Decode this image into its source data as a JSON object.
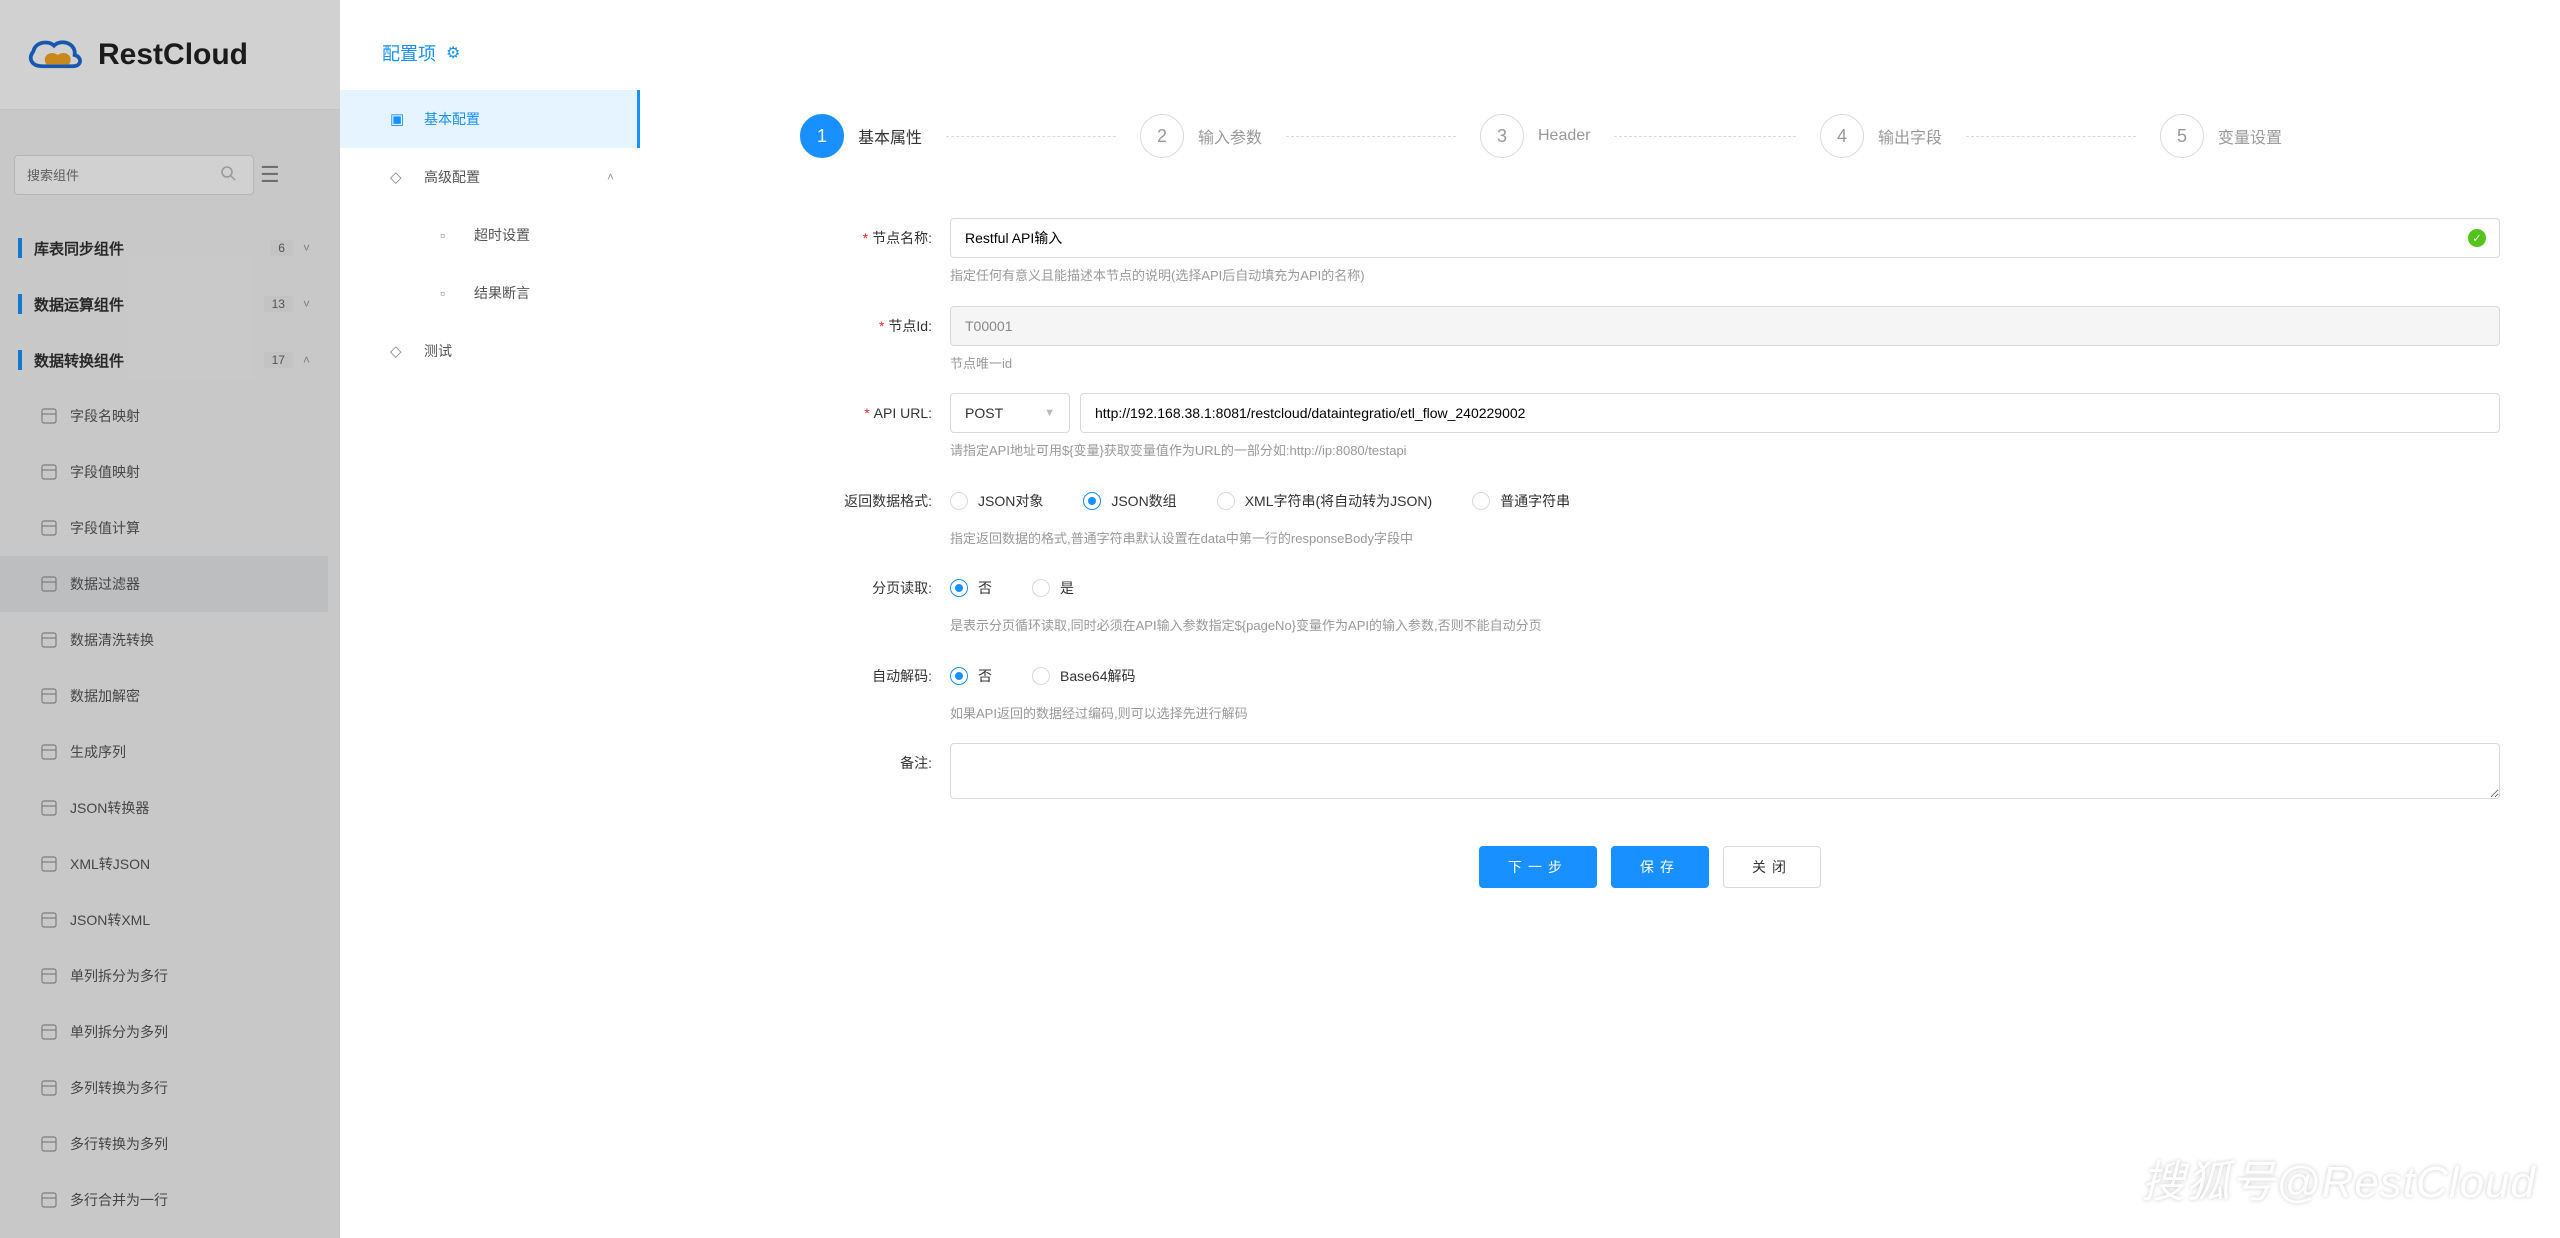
{
  "brand": "RestCloud",
  "search": {
    "placeholder": "搜索组件"
  },
  "leftNav": {
    "groups": [
      {
        "title": "库表同步组件",
        "count": "6",
        "expanded": false
      },
      {
        "title": "数据运算组件",
        "count": "13",
        "expanded": false
      },
      {
        "title": "数据转换组件",
        "count": "17",
        "expanded": true
      }
    ],
    "items": [
      "字段名映射",
      "字段值映射",
      "字段值计算",
      "数据过滤器",
      "数据清洗转换",
      "数据加解密",
      "生成序列",
      "JSON转换器",
      "XML转JSON",
      "JSON转XML",
      "单列拆分为多行",
      "单列拆分为多列",
      "多列转换为多行",
      "多行转换为多列",
      "多行合并为一行"
    ],
    "activeItemIndex": 3
  },
  "panel": {
    "title": "配置项",
    "tabs": [
      {
        "label": "基本配置",
        "active": true
      },
      {
        "label": "高级配置",
        "expandable": true
      },
      {
        "label": "超时设置",
        "sub": true
      },
      {
        "label": "结果断言",
        "sub": true
      },
      {
        "label": "测试"
      }
    ]
  },
  "steps": [
    {
      "num": "1",
      "label": "基本属性",
      "active": true
    },
    {
      "num": "2",
      "label": "输入参数"
    },
    {
      "num": "3",
      "label": "Header"
    },
    {
      "num": "4",
      "label": "输出字段"
    },
    {
      "num": "5",
      "label": "变量设置"
    }
  ],
  "form": {
    "nodeName": {
      "label": "节点名称:",
      "value": "Restful API输入",
      "help": "指定任何有意义且能描述本节点的说明(选择API后自动填充为API的名称)"
    },
    "nodeId": {
      "label": "节点Id:",
      "value": "T00001",
      "help": "节点唯一id"
    },
    "apiUrl": {
      "label": "API URL:",
      "method": "POST",
      "value": "http://192.168.38.1:8081/restcloud/dataintegratio/etl_flow_240229002",
      "help": "请指定API地址可用${变量}获取变量值作为URL的一部分如:http://ip:8080/testapi"
    },
    "respFmt": {
      "label": "返回数据格式:",
      "options": [
        "JSON对象",
        "JSON数组",
        "XML字符串(将自动转为JSON)",
        "普通字符串"
      ],
      "selected": 1,
      "help": "指定返回数据的格式,普通字符串默认设置在data中第一行的responseBody字段中"
    },
    "paging": {
      "label": "分页读取:",
      "options": [
        "否",
        "是"
      ],
      "selected": 0,
      "help": "是表示分页循环读取,同时必须在API输入参数指定${pageNo}变量作为API的输入参数,否则不能自动分页"
    },
    "decode": {
      "label": "自动解码:",
      "options": [
        "否",
        "Base64解码"
      ],
      "selected": 0,
      "help": "如果API返回的数据经过编码,则可以选择先进行解码"
    },
    "remark": {
      "label": "备注:",
      "value": ""
    }
  },
  "buttons": {
    "next": "下一步",
    "save": "保存",
    "close": "关闭"
  },
  "watermark": "搜狐号@RestCloud"
}
